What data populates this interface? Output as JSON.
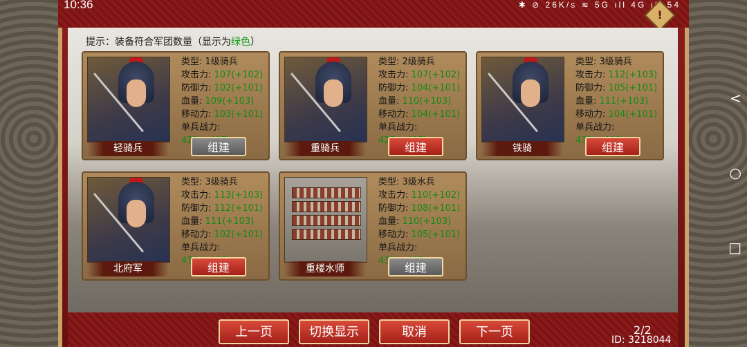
{
  "status": {
    "time": "10:36",
    "icons_text": "✱ ⊘ 26K/s ≋ 5G ıll 4G ıll 54"
  },
  "alert_icon": "!",
  "hint": {
    "prefix": "提示：装备符合军团数量（显示为",
    "highlight": "绿色",
    "suffix": "）"
  },
  "cards": [
    {
      "name": "轻骑兵",
      "type": "类型: 1级骑兵",
      "atk": "攻击力: ",
      "atk_val": "107(+102)",
      "def": "防御力: ",
      "def_val": "102(+101)",
      "hp": "血量: ",
      "hp_val": "109(+103)",
      "mov": "移动力: ",
      "mov_val": "103(+101)",
      "power": "单兵战力: ",
      "power_val": "421(+407)",
      "button": "组建",
      "button_enabled": false
    },
    {
      "name": "重骑兵",
      "type": "类型: 2级骑兵",
      "atk": "攻击力: ",
      "atk_val": "107(+102)",
      "def": "防御力: ",
      "def_val": "104(+101)",
      "hp": "血量: ",
      "hp_val": "110(+103)",
      "mov": "移动力: ",
      "mov_val": "104(+101)",
      "power": "单兵战力: ",
      "power_val": "425(+407)",
      "button": "组建",
      "button_enabled": true
    },
    {
      "name": "铁骑",
      "type": "类型: 3级骑兵",
      "atk": "攻击力: ",
      "atk_val": "112(+103)",
      "def": "防御力: ",
      "def_val": "105(+101)",
      "hp": "血量: ",
      "hp_val": "111(+103)",
      "mov": "移动力: ",
      "mov_val": "104(+101)",
      "power": "单兵战力: ",
      "power_val": "432(+408)",
      "button": "组建",
      "button_enabled": true
    },
    {
      "name": "北府军",
      "type": "类型: 3级骑兵",
      "atk": "攻击力: ",
      "atk_val": "113(+103)",
      "def": "防御力: ",
      "def_val": "112(+101)",
      "hp": "血量: ",
      "hp_val": "111(+103)",
      "mov": "移动力: ",
      "mov_val": "102(+101)",
      "power": "单兵战力: ",
      "power_val": "438(+408)",
      "button": "组建",
      "button_enabled": true
    },
    {
      "name": "重楼水师",
      "type": "类型: 3级水兵",
      "atk": "攻击力: ",
      "atk_val": "110(+102)",
      "def": "防御力: ",
      "def_val": "108(+101)",
      "hp": "血量: ",
      "hp_val": "110(+103)",
      "mov": "移动力: ",
      "mov_val": "105(+101)",
      "power": "单兵战力: ",
      "power_val": "433(+407)",
      "button": "组建",
      "button_enabled": false
    }
  ],
  "nav": {
    "prev": "上一页",
    "toggle": "切换显示",
    "cancel": "取消",
    "next": "下一页"
  },
  "page": "2/2",
  "id": "ID: 3218044",
  "colors": {
    "bonus_green": "#138a13",
    "button_red": "#c0301f",
    "frame_red": "#8c1d1d"
  }
}
